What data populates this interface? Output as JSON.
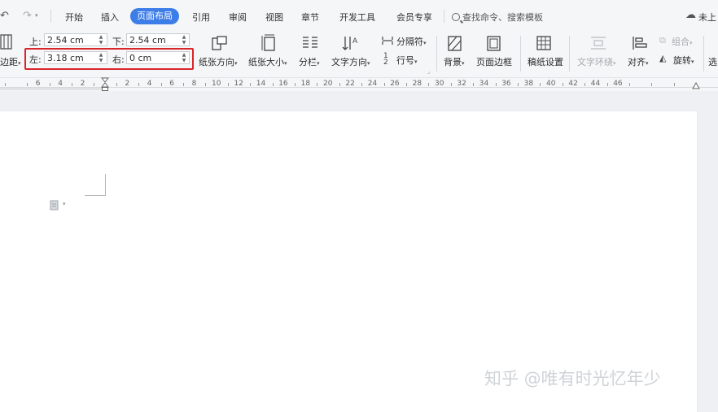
{
  "tabs": {
    "items": [
      "开始",
      "插入",
      "页面布局",
      "引用",
      "审阅",
      "视图",
      "章节",
      "开发工具",
      "会员专享"
    ],
    "active": "页面布局",
    "search_placeholder": "查找命令、搜索模板",
    "right_label": "未上"
  },
  "margins": {
    "top_label": "上:",
    "top_value": "2.54 cm",
    "bottom_label": "下:",
    "bottom_value": "2.54 cm",
    "left_label": "左:",
    "left_value": "3.18 cm",
    "right_label": "右:",
    "right_value": "0 cm",
    "button_label": "边距"
  },
  "ribbon": {
    "orientation": "纸张方向",
    "size": "纸张大小",
    "columns": "分栏",
    "text_direction": "文字方向",
    "separator": "分隔符",
    "line_number": "行号",
    "background": "背景",
    "page_border": "页面边框",
    "manuscript": "稿纸设置",
    "text_wrap": "文字环绕",
    "align": "对齐",
    "group": "组合",
    "rotate": "旋转",
    "select_pane": "选"
  },
  "ruler": [
    "6",
    "4",
    "2",
    "2",
    "4",
    "6",
    "8",
    "10",
    "12",
    "14",
    "16",
    "18",
    "20",
    "22",
    "24",
    "26",
    "28",
    "30",
    "32",
    "34",
    "36",
    "38",
    "40",
    "42",
    "44",
    "46"
  ],
  "watermark": "知乎 @唯有时光忆年少",
  "colors": {
    "accent": "#3d7de8",
    "highlight": "#d8262b"
  }
}
